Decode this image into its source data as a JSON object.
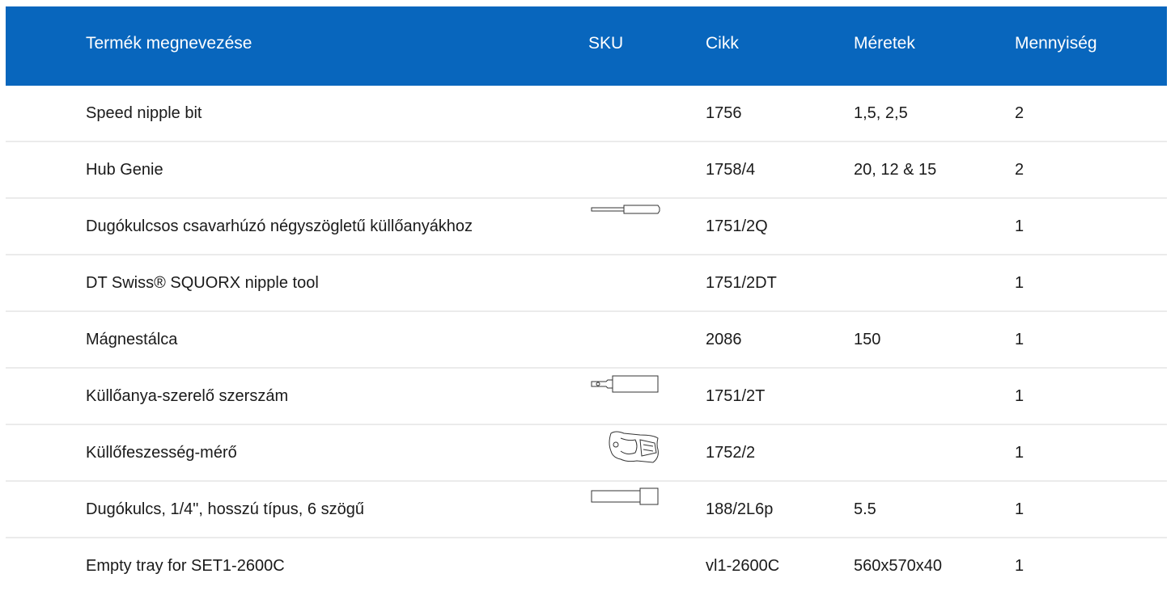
{
  "headers": {
    "name": "Termék megnevezése",
    "sku": "SKU",
    "cikk": "Cikk",
    "size": "Méretek",
    "qty": "Mennyiség"
  },
  "colors": {
    "header_bg": "#0866bd",
    "header_text": "#ffffff",
    "divider": "#ebebeb"
  },
  "rows": [
    {
      "name": "Speed nipple bit",
      "icon": "",
      "cikk": "1756",
      "size": "1,5, 2,5",
      "qty": "2"
    },
    {
      "name": "Hub Genie",
      "icon": "",
      "cikk": "1758/4",
      "size": "20, 12 & 15",
      "qty": "2"
    },
    {
      "name": "Dugókulcsos csavarhúzó négyszögletű küllőanyákhoz",
      "icon": "screwdriver-icon",
      "cikk": "1751/2Q",
      "size": "",
      "qty": "1"
    },
    {
      "name": "DT Swiss® SQUORX nipple tool",
      "icon": "",
      "cikk": "1751/2DT",
      "size": "",
      "qty": "1"
    },
    {
      "name": "Mágnestálca",
      "icon": "",
      "cikk": "2086",
      "size": "150",
      "qty": "1"
    },
    {
      "name": "Küllőanya-szerelő szerszám",
      "icon": "nipple-driver-icon",
      "cikk": "1751/2T",
      "size": "",
      "qty": "1"
    },
    {
      "name": "Küllőfeszesség-mérő",
      "icon": "tension-meter-icon",
      "cikk": "1752/2",
      "size": "",
      "qty": "1"
    },
    {
      "name": "Dugókulcs, 1/4\", hosszú típus, 6 szögű",
      "icon": "socket-icon",
      "cikk": "188/2L6p",
      "size": "5.5",
      "qty": "1"
    },
    {
      "name": "Empty tray for SET1-2600C",
      "icon": "",
      "cikk": "vl1-2600C",
      "size": "560x570x40",
      "qty": "1"
    }
  ]
}
